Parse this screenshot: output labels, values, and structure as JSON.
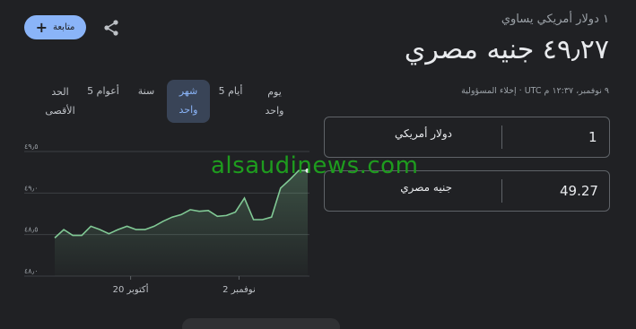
{
  "header": {
    "subtitle": "١ دولار أمريكي يساوي",
    "rate": "٤٩٫٢٧ جنيه مصري",
    "timestamp": "٩ نوفمبر، ١٢:٣٧ م UTC · ",
    "disclaimer": "إخلاء المسؤولية",
    "follow_label": "متابعة",
    "follow_icon": "plus-icon",
    "share_icon": "share-icon"
  },
  "tabs": [
    {
      "label": "يوم\nواحد",
      "active": false
    },
    {
      "label": "5 أيام",
      "active": false
    },
    {
      "label": "شهر\nواحد",
      "active": true
    },
    {
      "label": "سنة",
      "active": false
    },
    {
      "label": "5 أعوام",
      "active": false
    },
    {
      "label": "الحد\nالأقصى",
      "active": false
    }
  ],
  "converter": {
    "from": {
      "amount": "1",
      "currency": "دولار أمريكي"
    },
    "to": {
      "amount": "49.27",
      "currency": "جنيه مصري"
    }
  },
  "watermark": "alsaudinews.com",
  "colors": {
    "accent": "#8ab4f8",
    "chart_line": "#81c995",
    "watermark": "#1e9c1e"
  },
  "chart_data": {
    "type": "area",
    "y_tick_labels": [
      "٤٩٫٥",
      "٤٩٫٠",
      "٤٨٫٥",
      "٤٨٫٠"
    ],
    "x_tick_labels": [
      "20 أكتوبر",
      "2 نوفمبر"
    ],
    "ylim": [
      48.0,
      49.5
    ],
    "grid": true,
    "values": [
      48.46,
      48.56,
      48.49,
      48.49,
      48.6,
      48.56,
      48.51,
      48.56,
      48.6,
      48.56,
      48.56,
      48.6,
      48.66,
      48.71,
      48.74,
      48.8,
      48.78,
      48.79,
      48.72,
      48.73,
      48.77,
      48.94,
      48.68,
      48.68,
      48.71,
      49.06,
      49.16,
      49.27,
      49.27
    ]
  },
  "more_bar": ""
}
